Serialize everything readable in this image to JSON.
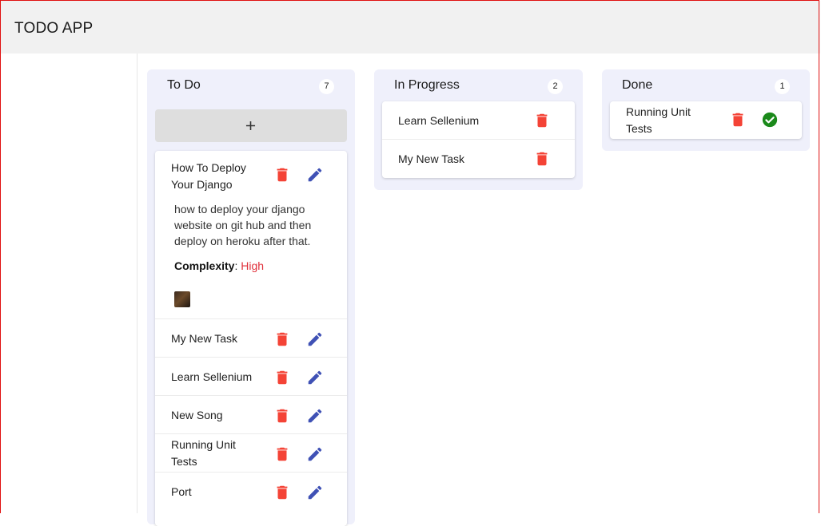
{
  "app": {
    "title": "TODO APP"
  },
  "colors": {
    "delete": "#f44336",
    "edit": "#3f51b5",
    "done_check": "#1b8a1b",
    "complexity_high": "#e0303a",
    "column_bg": "#eff0fb"
  },
  "columns": {
    "todo": {
      "title": "To Do",
      "count": "7",
      "add_icon": "plus-icon",
      "cards": [
        {
          "title": "How To Deploy Your Django",
          "description": "how to deploy your django website on git hub and then deploy on heroku after that.",
          "complexity_label": "Complexity",
          "complexity_value": "High",
          "has_avatar": true
        },
        {
          "title": "My New Task"
        },
        {
          "title": "Learn Sellenium"
        },
        {
          "title": "New Song"
        },
        {
          "title": "Running Unit Tests"
        },
        {
          "title": "Port"
        }
      ]
    },
    "in_progress": {
      "title": "In Progress",
      "count": "2",
      "cards": [
        {
          "title": "Learn Sellenium"
        },
        {
          "title": "My New Task"
        }
      ]
    },
    "done": {
      "title": "Done",
      "count": "1",
      "cards": [
        {
          "title": "Running Unit Tests"
        }
      ]
    }
  }
}
